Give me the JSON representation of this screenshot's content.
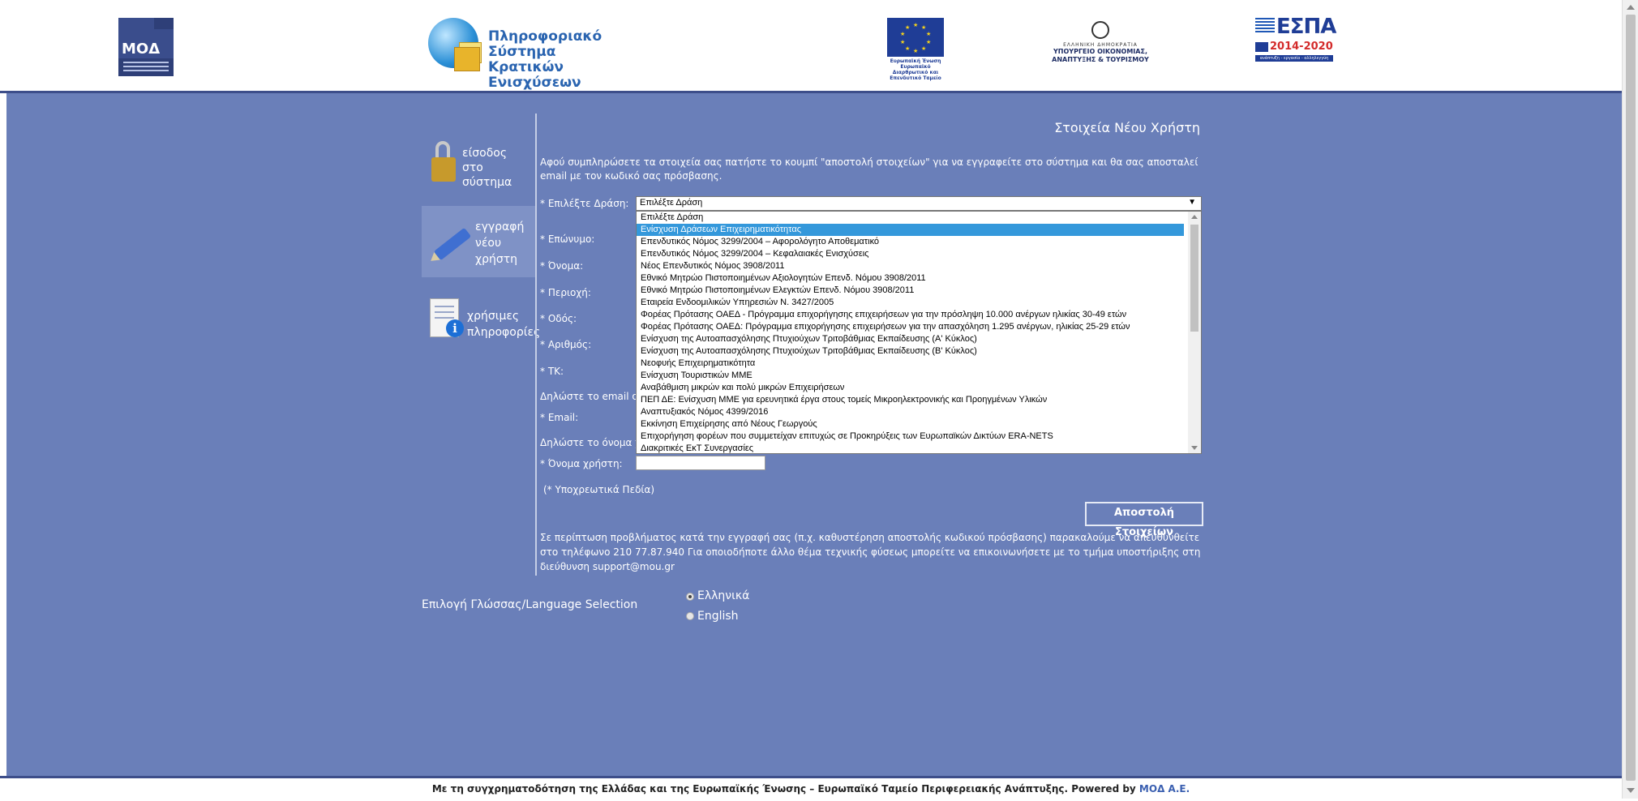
{
  "header": {
    "mod_logo_text": "ΜΟΔ Α.Ε.",
    "ps_logo_text_line1": "Πληροφοριακό Σύστημα",
    "ps_logo_text_line2": "Κρατικών Ενισχύσεων",
    "eu_logo_caption": "Ευρωπαϊκή Ένωση Ευρωπαϊκό Διαρθρωτικό και Επενδυτικό Ταμείο",
    "gr_logo_line1": "ΕΛΛΗΝΙΚΗ ΔΗΜΟΚΡΑΤΙΑ",
    "gr_logo_line2": "ΥΠΟΥΡΓΕΙΟ ΟΙΚΟΝΟΜΙΑΣ,",
    "gr_logo_line3": "ΑΝΑΠΤΥΞΗΣ & ΤΟΥΡΙΣΜΟΥ",
    "espa_logo_text": "ΕΣΠΑ",
    "espa_logo_years": "2014-2020",
    "espa_logo_tagline": "ανάπτυξη - εργασία - αλληλεγγύη"
  },
  "sidebar": {
    "login_label": "είσοδος στο σύστημα",
    "register_label": "εγγραφή νέου χρήστη",
    "info_label": "χρήσιμες πληροφορίες"
  },
  "form": {
    "title": "Στοιχεία Νέου Χρήστη",
    "intro": "Αφού συμπληρώσετε τα στοιχεία σας πατήστε το κουμπί \"αποστολή στοιχείων\" για να εγγραφείτε στο σύστημα και θα σας αποσταλεί email με τον κωδικό σας πρόσβασης.",
    "action_label": "* Επιλέξτε Δράση:",
    "action_selected": "Επιλέξτε Δράση",
    "action_options": [
      "Επιλέξτε Δράση",
      "Ενίσχυση Δράσεων Επιχειρηματικότητας",
      "Επενδυτικός Νόμος 3299/2004 – Αφορολόγητο Αποθεματικό",
      "Επενδυτικός Νόμος 3299/2004 – Κεφαλαιακές Ενισχύσεις",
      "Νέος Επενδυτικός Νόμος 3908/2011",
      "Εθνικό Μητρώο Πιστοποιημένων Αξιολογητών Επενδ. Νόμου 3908/2011",
      "Εθνικό Μητρώο Πιστοποιημένων Ελεγκτών Επενδ. Νόμου 3908/2011",
      "Εταιρεία Ενδοομιλικών Υπηρεσιών Ν. 3427/2005",
      "Φορέας Πρότασης ΟΑΕΔ - Πρόγραμμα επιχορήγησης επιχειρήσεων για την πρόσληψη 10.000 ανέργων ηλικίας 30-49 ετών",
      "Φορέας Πρότασης ΟΑΕΔ: Πρόγραμμα επιχορήγησης επιχειρήσεων για την απασχόληση 1.295 ανέργων, ηλικίας 25-29 ετών",
      "Ενίσχυση της Αυτοαπασχόλησης Πτυχιούχων Τριτοβάθμιας Εκπαίδευσης (Α' Κύκλος)",
      "Ενίσχυση της Αυτοαπασχόλησης Πτυχιούχων Τριτοβάθμιας Εκπαίδευσης (Β' Κύκλος)",
      "Νεοφυής Επιχειρηματικότητα",
      "Ενίσχυση Τουριστικών ΜΜΕ",
      "Αναβάθμιση μικρών και πολύ μικρών Επιχειρήσεων",
      "ΠΕΠ ΔΕ: Ενίσχυση ΜΜΕ για ερευνητικά έργα στους τομείς Μικροηλεκτρονικής και Προηγμένων Υλικών",
      "Αναπτυξιακός Νόμος 4399/2016",
      "Εκκίνηση Επιχείρησης από Νέους Γεωργούς",
      "Επιχορήγηση φορέων που συμμετείχαν επιτυχώς σε Προκηρύξεις των Ευρωπαϊκών Δικτύων ERA-NETS",
      "Διακριτικές ΕκΤ Συνεργασίες"
    ],
    "surname_label": "* Επώνυμο:",
    "name_label": "* Όνομα:",
    "region_label": "* Περιοχή:",
    "street_label": "* Οδός:",
    "number_label": "* Αριθμός:",
    "zip_label": "* ΤΚ:",
    "email_hint": "Δηλώστε το email σ",
    "email_label": "* Email:",
    "username_hint": "Δηλώστε το όνομα χ",
    "username_label": "* Όνομα χρήστη:",
    "required_note": "(* Υποχρεωτικά Πεδία)",
    "submit_label": "Αποστολή Στοιχείων",
    "help_text": "Σε περίπτωση προβλήματος κατά την εγγραφή σας (π.χ. καθυστέρηση αποστολής κωδικού πρόσβασης) παρακαλούμε να απευθυνθείτε στο τηλέφωνο 210 77.87.940 Για οποιοδήποτε άλλο θέμα τεχνικής φύσεως μπορείτε να επικοινωνήσετε με το τμήμα υποστήριξης στη διεύθυνση support@mou.gr"
  },
  "language": {
    "label": "Επιλογή Γλώσσας/Language Selection",
    "greek": "Ελληνικά",
    "english": "English",
    "selected": "Ελληνικά"
  },
  "footer": {
    "text": "Με τη συγχρηματοδότηση της Ελλάδας και της Ευρωπαϊκής Ένωσης – Ευρωπαϊκό Ταμείο Περιφερειακής Ανάπτυξης.  Powered by ",
    "brand": "ΜΟΔ Α.Ε."
  },
  "colors": {
    "background": "#6a7fb9",
    "active_sidebar": "#7f92c6",
    "selected_option": "#3498db"
  }
}
